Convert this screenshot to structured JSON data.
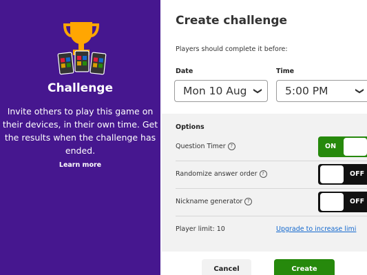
{
  "promo": {
    "title": "Challenge",
    "description": "Invite others to play this game on their devices, in their own time. Get the results when the challenge has ended.",
    "learn_more": "Learn more"
  },
  "form": {
    "title": "Create challenge",
    "subtitle": "Players should complete it before:",
    "date_label": "Date",
    "date_value": "Mon 10 Aug",
    "time_label": "Time",
    "time_value": "5:00 PM"
  },
  "options": {
    "title": "Options",
    "question_timer": {
      "label": "Question Timer",
      "state": "ON"
    },
    "randomize_order": {
      "label": "Randomize answer order",
      "state": "OFF"
    },
    "nickname_generator": {
      "label": "Nickname generator",
      "state": "OFF"
    },
    "player_limit": {
      "label": "Player limit: 10",
      "link": "Upgrade to increase limi"
    }
  },
  "actions": {
    "cancel": "Cancel",
    "create": "Create"
  },
  "colors": {
    "promo_bg": "#46178f",
    "accent_green": "#26890c",
    "toggle_off": "#111111",
    "link_blue": "#1368ce"
  },
  "icons": {
    "trophy": "trophy-icon",
    "phones": "devices-icon",
    "help": "help-icon",
    "chevron": "chevron-down-icon"
  }
}
